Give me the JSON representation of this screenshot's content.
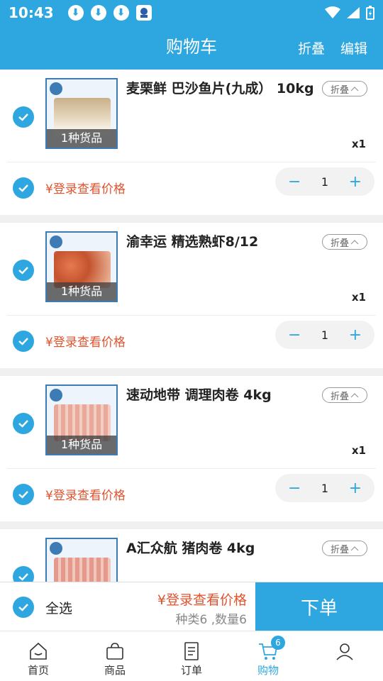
{
  "status_bar": {
    "time": "10:43"
  },
  "header": {
    "title": "购物车",
    "fold_label": "折叠",
    "edit_label": "编辑"
  },
  "cart_items": [
    {
      "title": "麦栗鲜 巴沙鱼片(九成） 10kg",
      "goods_count_label": "1种货品",
      "fold_label": "折叠",
      "quantity_label": "x1",
      "price_text": "¥登录查看价格",
      "quantity": "1"
    },
    {
      "title": "渝幸运 精选熟虾8/12",
      "goods_count_label": "1种货品",
      "fold_label": "折叠",
      "quantity_label": "x1",
      "price_text": "¥登录查看价格",
      "quantity": "1"
    },
    {
      "title": "速动地带 调理肉卷 4kg",
      "goods_count_label": "1种货品",
      "fold_label": "折叠",
      "quantity_label": "x1",
      "price_text": "¥登录查看价格",
      "quantity": "1"
    },
    {
      "title": "A汇众航 猪肉卷 4kg",
      "fold_label": "折叠"
    }
  ],
  "footer": {
    "select_all_label": "全选",
    "price_text": "¥登录查看价格",
    "summary": "种类6 ,数量6",
    "order_button": "下单"
  },
  "tabs": [
    {
      "label": "首页",
      "icon": "home-icon"
    },
    {
      "label": "商品",
      "icon": "bag-icon"
    },
    {
      "label": "订单",
      "icon": "order-icon"
    },
    {
      "label": "购物",
      "icon": "cart-icon",
      "badge": "6",
      "active": true
    },
    {
      "label": "",
      "icon": "user-icon"
    }
  ],
  "colors": {
    "primary": "#2ea7e0",
    "price": "#e0532e"
  }
}
